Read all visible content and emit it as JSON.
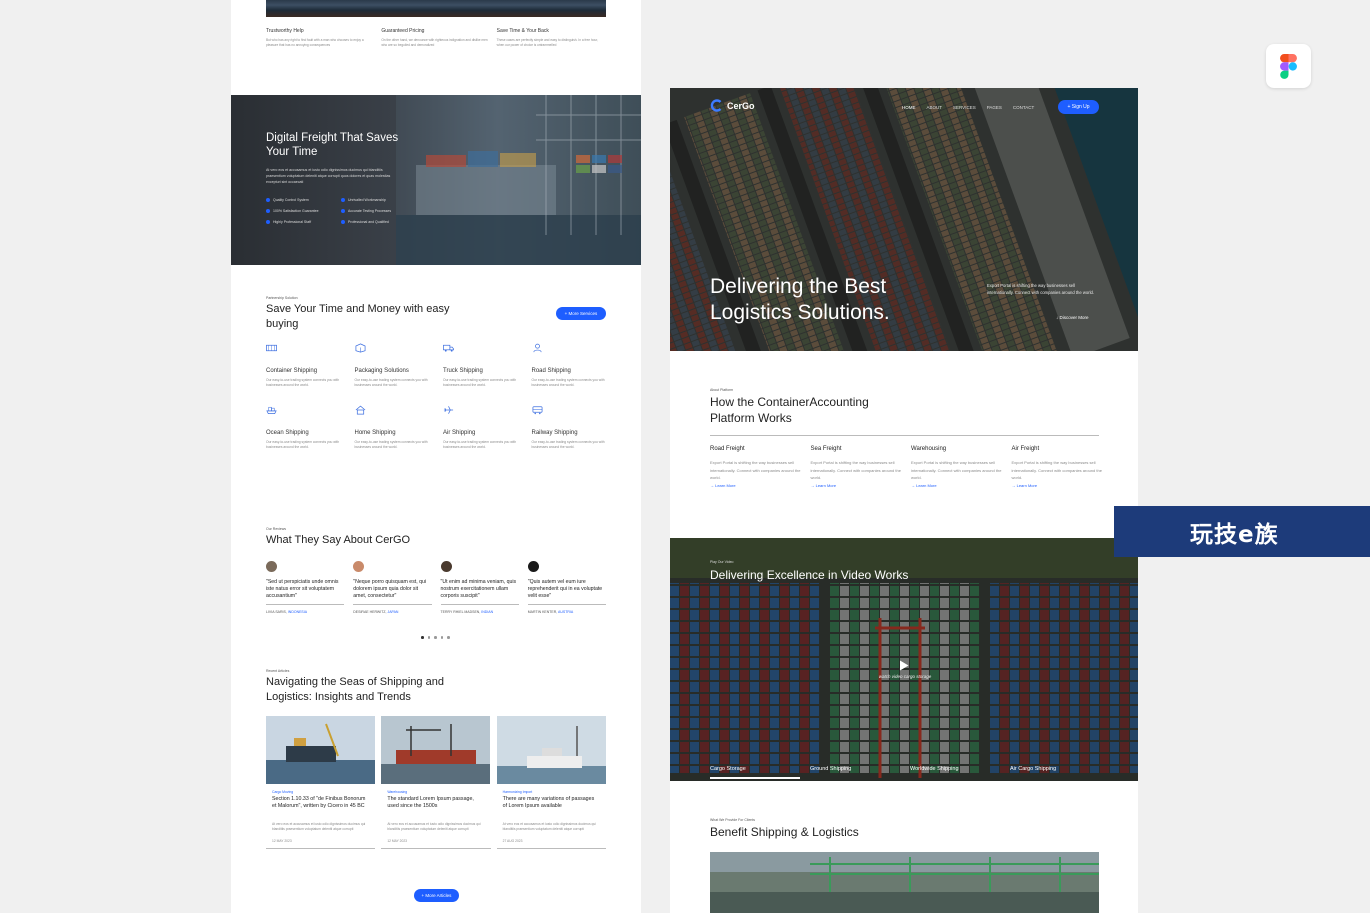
{
  "left": {
    "top_features": [
      {
        "title": "Trustworthy Help",
        "text": "But who has any right to find fault with a man who chooses to enjoy a pleasure that has no annoying consequences"
      },
      {
        "title": "Guaranteed Pricing",
        "text": "On the other hand, we denounce with righteous indignation and dislike men who are so beguiled and demoralized"
      },
      {
        "title": "Save Time & Your Back",
        "text": "These cases are perfectly simple and easy to distinguish. In a free hour, when our power of choice is untrammelled"
      }
    ],
    "hero": {
      "title": "Digital Freight That Saves Your Time",
      "text": "At vero eos et accusamus et iusto odio dignissimos ducimus qui blanditiis praesentium voluptatum deleniti atque corrupti quos dolores et quas molestias excepturi sint occaecati",
      "checks": [
        "Quality Control System",
        "Unrivalled Workmanship",
        "100% Satisfaction Guarantee",
        "Accurate Testing Processes",
        "Highly Professional Staff",
        "Professional and Qualified"
      ]
    },
    "services": {
      "eyebrow": "Partnership Solution",
      "title": "Save Your Time and Money with easy buying",
      "button": "+ More Services",
      "items": [
        {
          "title": "Container Shipping",
          "icon": "container-icon",
          "text": "Our easy-to-use trading system connects you with businesses around the world."
        },
        {
          "title": "Packaging Solutions",
          "icon": "box-icon",
          "text": "Our easy-to-use trading system connects you with businesses around the world."
        },
        {
          "title": "Truck Shipping",
          "icon": "truck-icon",
          "text": "Our easy-to-use trading system connects you with businesses around the world."
        },
        {
          "title": "Road Shipping",
          "icon": "driver-icon",
          "text": "Our easy-to-use trading system connects you with businesses around the world."
        },
        {
          "title": "Ocean Shipping",
          "icon": "ship-icon",
          "text": "Our easy-to-use trading system connects you with businesses around the world."
        },
        {
          "title": "Home Shipping",
          "icon": "home-icon",
          "text": "Our easy-to-use trading system connects you with businesses around the world."
        },
        {
          "title": "Air Shipping",
          "icon": "plane-icon",
          "text": "Our easy-to-use trading system connects you with businesses around the world."
        },
        {
          "title": "Railway Shipping",
          "icon": "train-icon",
          "text": "Our easy-to-use trading system connects you with businesses around the world."
        }
      ]
    },
    "testimonials": {
      "eyebrow": "Our Reviews",
      "title": "What They Say About CerGO",
      "items": [
        {
          "quote": "\"Sed ut perspiciatis unde omnis iste natus error sit voluptatem accusantium\"",
          "name": "LIVIA SARIS,",
          "company": "INDONESIA",
          "avatar": "#7a6a5a"
        },
        {
          "quote": "\"Neque porro quisquam est, qui dolorem ipsum quia dolor sit amet, consectetur\"",
          "name": "DESIRAE HERWITZ,",
          "company": "JAPAN",
          "avatar": "#c98a6a"
        },
        {
          "quote": "\"Ut enim ad minima veniam, quis nostrum exercitationem ullam corporis suscipit\"",
          "name": "TERRY RHIEL MADSEN,",
          "company": "INDIAN",
          "avatar": "#4a3a2e"
        },
        {
          "quote": "\"Quis autem vel eum iure reprehenderit qui in ea voluptate velit esse\"",
          "name": "MARTIN KENTER,",
          "company": "AUSTRIA",
          "avatar": "#1a1a1a"
        }
      ]
    },
    "articles": {
      "eyebrow": "Recent Articles",
      "title": "Navigating the Seas of Shipping and Logistics: Insights and Trends",
      "button": "+ More Articles",
      "items": [
        {
          "category": "Cargo Moving",
          "title": "Section 1.10.33 of \"de Finibus Bonorum et Malorum\", written by Cicero in 45 BC",
          "text": "At vero eos et accusamus et iusto odio dignissimos ducimus qui blanditiis praesentium voluptatum deleniti atque corrupti",
          "date": "12 MAY 2023"
        },
        {
          "category": "Warehousing",
          "title": "The standard Lorem Ipsum passage, used since the 1500s",
          "text": "At vero eos et accusamus et iusto odio dignissimos ducimus qui blanditiis praesentium voluptatum deleniti atque corrupti",
          "date": "12 MAY 2023"
        },
        {
          "category": "Harmonizing Import",
          "title": "There are many variations of passages of Lorem Ipsum available",
          "text": "At vero eos et accusamus et iusto odio dignissimos ducimus qui blanditiis praesentium voluptatum deleniti atque corrupti",
          "date": "27 AUG 2023"
        }
      ]
    }
  },
  "right": {
    "nav": {
      "brand": "CerGo",
      "links": [
        "HOME",
        "ABOUT",
        "SERVICES",
        "PAGES",
        "CONTACT"
      ],
      "signup": "+ Sign Up"
    },
    "hero": {
      "title": "Delivering the Best Logistics Solutions.",
      "side_text": "Export Portal is shifting the way businesses sell internationally. Connect with companies around the world.",
      "discover": "↓ Discover More"
    },
    "platform": {
      "eyebrow": "About Platform",
      "title": "How the ContainerAccounting Platform Works",
      "columns": [
        {
          "title": "Road Freight",
          "text": "Export Portal is shifting the way businesses sell internationally. Connect with companies around the world.",
          "link": "→ Learn More"
        },
        {
          "title": "Sea Freight",
          "text": "Export Portal is shifting the way businesses sell internationally. Connect with companies around the world.",
          "link": "→ Learn More"
        },
        {
          "title": "Warehousing",
          "text": "Export Portal is shifting the way businesses sell internationally. Connect with companies around the world.",
          "link": "→ Learn More"
        },
        {
          "title": "Air Freight",
          "text": "Export Portal is shifting the way businesses sell internationally. Connect with companies around the world.",
          "link": "→ Learn More"
        }
      ]
    },
    "video": {
      "eyebrow": "Play Our Video",
      "title": "Delivering Excellence in Video Works",
      "caption": "watch video cargo storage",
      "tabs": [
        "Cargo Storage",
        "Ground Shipping",
        "Worldwide Shipping",
        "Air Cargo Shipping"
      ]
    },
    "benefit": {
      "eyebrow": "What We Provide For Clients",
      "title": "Benefit Shipping & Logistics"
    }
  },
  "watermark": "玩技e族",
  "colors": {
    "accent": "#1e5eff",
    "banner": "#1d3b7a"
  }
}
